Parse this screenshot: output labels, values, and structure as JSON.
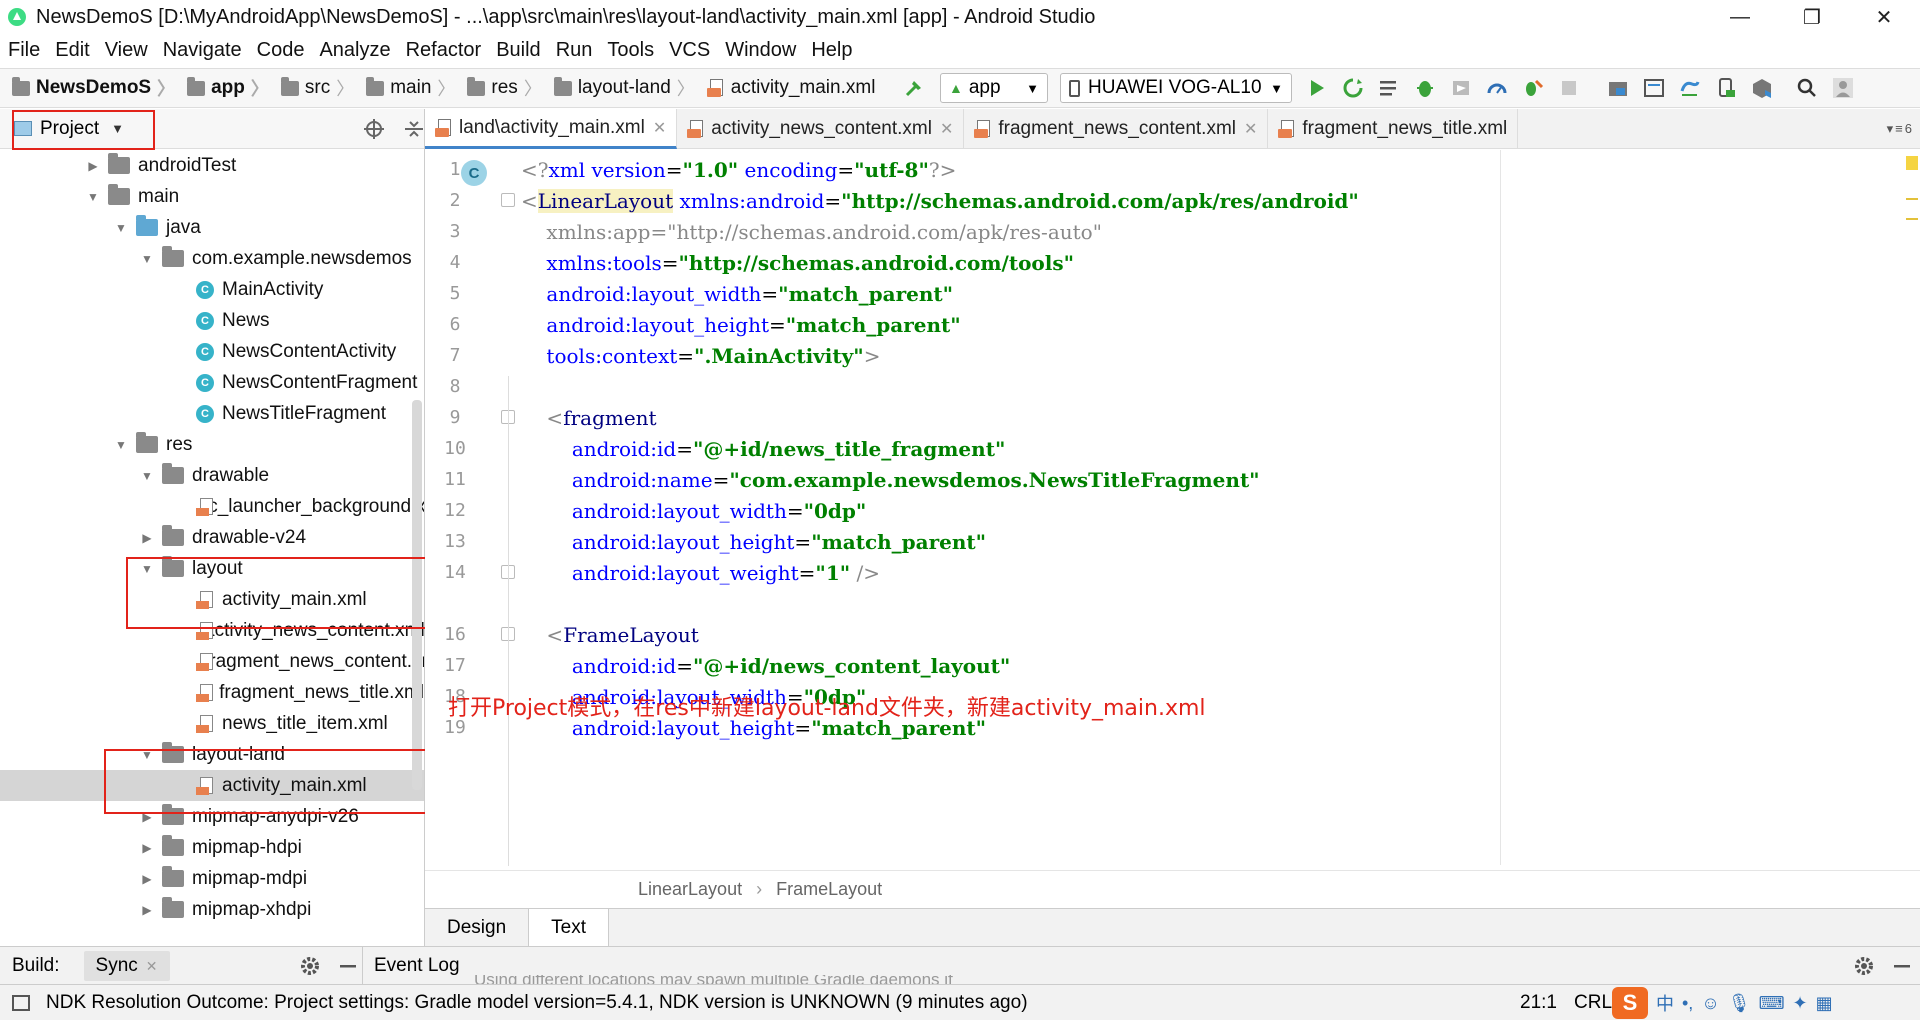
{
  "window": {
    "title": "NewsDemoS [D:\\MyAndroidApp\\NewsDemoS] - ...\\app\\src\\main\\res\\layout-land\\activity_main.xml [app] - Android Studio",
    "minimize": "—",
    "maximize": "❐",
    "close": "✕"
  },
  "menu": [
    "File",
    "Edit",
    "View",
    "Navigate",
    "Code",
    "Analyze",
    "Refactor",
    "Build",
    "Run",
    "Tools",
    "VCS",
    "Window",
    "Help"
  ],
  "breadcrumb": [
    "NewsDemoS",
    "app",
    "src",
    "main",
    "res",
    "layout-land",
    "activity_main.xml"
  ],
  "toolbar": {
    "config": "app",
    "device": "HUAWEI VOG-AL10"
  },
  "project_panel": {
    "view_mode": "Project"
  },
  "tree": [
    {
      "label": "androidTest",
      "depth": 1,
      "type": "folder",
      "state": "collapsed"
    },
    {
      "label": "main",
      "depth": 1,
      "type": "folder",
      "state": "expanded"
    },
    {
      "label": "java",
      "depth": 2,
      "type": "folder-blue",
      "state": "expanded"
    },
    {
      "label": "com.example.newsdemos",
      "depth": 3,
      "type": "folder",
      "state": "expanded"
    },
    {
      "label": "MainActivity",
      "depth": 4,
      "type": "class"
    },
    {
      "label": "News",
      "depth": 4,
      "type": "class"
    },
    {
      "label": "NewsContentActivity",
      "depth": 4,
      "type": "class"
    },
    {
      "label": "NewsContentFragment",
      "depth": 4,
      "type": "class"
    },
    {
      "label": "NewsTitleFragment",
      "depth": 4,
      "type": "class"
    },
    {
      "label": "res",
      "depth": 2,
      "type": "folder",
      "state": "expanded"
    },
    {
      "label": "drawable",
      "depth": 3,
      "type": "folder",
      "state": "expanded"
    },
    {
      "label": "ic_launcher_background.xml",
      "depth": 4,
      "type": "xml"
    },
    {
      "label": "drawable-v24",
      "depth": 3,
      "type": "folder",
      "state": "collapsed"
    },
    {
      "label": "layout",
      "depth": 3,
      "type": "folder",
      "state": "expanded"
    },
    {
      "label": "activity_main.xml",
      "depth": 4,
      "type": "xml"
    },
    {
      "label": "activity_news_content.xml",
      "depth": 4,
      "type": "xml"
    },
    {
      "label": "fragment_news_content.xml",
      "depth": 4,
      "type": "xml"
    },
    {
      "label": "fragment_news_title.xml",
      "depth": 4,
      "type": "xml"
    },
    {
      "label": "news_title_item.xml",
      "depth": 4,
      "type": "xml"
    },
    {
      "label": "layout-land",
      "depth": 3,
      "type": "folder",
      "state": "expanded"
    },
    {
      "label": "activity_main.xml",
      "depth": 4,
      "type": "xml",
      "selected": true
    },
    {
      "label": "mipmap-anydpi-v26",
      "depth": 3,
      "type": "folder",
      "state": "collapsed"
    },
    {
      "label": "mipmap-hdpi",
      "depth": 3,
      "type": "folder",
      "state": "collapsed"
    },
    {
      "label": "mipmap-mdpi",
      "depth": 3,
      "type": "folder",
      "state": "collapsed"
    },
    {
      "label": "mipmap-xhdpi",
      "depth": 3,
      "type": "folder",
      "state": "collapsed"
    }
  ],
  "tabs": [
    {
      "label": "land\\activity_main.xml",
      "active": true
    },
    {
      "label": "activity_news_content.xml",
      "active": false
    },
    {
      "label": "fragment_news_content.xml",
      "active": false
    },
    {
      "label": "fragment_news_title.xml",
      "active": false
    }
  ],
  "tabs_overflow": "6",
  "line_numbers": [
    "1",
    "2",
    "3",
    "4",
    "5",
    "6",
    "7",
    "8",
    "9",
    "10",
    "11",
    "12",
    "13",
    "14",
    "16",
    "17",
    "18",
    "19"
  ],
  "code": {
    "l1_a": "<?",
    "l1_b": "xml version",
    "l1_c": "=",
    "l1_d": "\"1.0\"",
    "l1_e": " encoding",
    "l1_f": "=",
    "l1_g": "\"utf-8\"",
    "l1_h": "?>",
    "l2_a": "<",
    "l2_b": "LinearLayout",
    "l2_c": " xmlns:android",
    "l2_d": "=",
    "l2_e": "\"http://schemas.android.com/apk/res/android\"",
    "l3": "    xmlns:app=\"http://schemas.android.com/apk/res-auto\"",
    "l4_a": "    xmlns:tools",
    "l4_b": "=",
    "l4_c": "\"http://schemas.android.com/tools\"",
    "l5_a": "    android:layout_width",
    "l5_b": "=",
    "l5_c": "\"match_parent\"",
    "l6_a": "    android:layout_height",
    "l6_b": "=",
    "l6_c": "\"match_parent\"",
    "l7_a": "    tools:context",
    "l7_b": "=",
    "l7_c": "\".MainActivity\"",
    "l7_d": ">",
    "l9_a": "    <",
    "l9_b": "fragment",
    "l10_a": "        android:id",
    "l10_b": "=",
    "l10_c": "\"@+id/news_title_fragment\"",
    "l11_a": "        android:name",
    "l11_b": "=",
    "l11_c": "\"com.example.newsdemos.NewsTitleFragment\"",
    "l12_a": "        android:layout_width",
    "l12_b": "=",
    "l12_c": "\"0dp\"",
    "l13_a": "        android:layout_height",
    "l13_b": "=",
    "l13_c": "\"match_parent\"",
    "l14_a": "        android:layout_weight",
    "l14_b": "=",
    "l14_c": "\"1\"",
    "l14_d": " />",
    "l16_a": "    <",
    "l16_b": "FrameLayout",
    "l17_a": "        android:id",
    "l17_b": "=",
    "l17_c": "\"@+id/news_content_layout\"",
    "l18_a": "        android:layout_width",
    "l18_b": "=",
    "l18_c": "\"0dp\"",
    "l19_a": "        android:layout_height",
    "l19_b": "=",
    "l19_c": "\"match_parent\""
  },
  "gutter_badge": "C",
  "annotation": "打开Project模式，在res中新建layout-land文件夹，新建activity_main.xml",
  "editor_breadcrumb": [
    "LinearLayout",
    "FrameLayout"
  ],
  "editor_breadcrumb_sep": "›",
  "design_tabs": [
    "Design",
    "Text"
  ],
  "bottom_panel": {
    "build_label": "Build:",
    "sync_tab": "Sync",
    "event_log": "Event Log",
    "ghost_message": "Using different locations may spawn multiple Gradle daemons if"
  },
  "status": {
    "message": "NDK Resolution Outcome: Project settings: Gradle model version=5.4.1, NDK version is UNKNOWN (9 minutes ago)",
    "position": "21:1",
    "line_ending": "CRLF"
  },
  "colors": {
    "accent_red": "#e2231a",
    "tag_navy": "#000080",
    "attr_blue": "#0000ff",
    "string_green": "#008000",
    "class_icon": "#36b3c9",
    "run_green": "#3ba33b"
  }
}
